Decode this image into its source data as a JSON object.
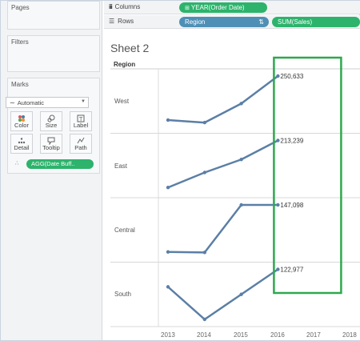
{
  "sidebar": {
    "pages_title": "Pages",
    "filters_title": "Filters",
    "marks_title": "Marks",
    "mark_type": "Automatic",
    "mark_buttons": [
      {
        "label": "Color",
        "icon": "color-dots-icon"
      },
      {
        "label": "Size",
        "icon": "size-icon"
      },
      {
        "label": "Label",
        "icon": "label-icon"
      },
      {
        "label": "Detail",
        "icon": "detail-icon"
      },
      {
        "label": "Tooltip",
        "icon": "tooltip-icon"
      },
      {
        "label": "Path",
        "icon": "path-icon"
      }
    ],
    "mark_field": "AGG(Date Buff.."
  },
  "shelves": {
    "columns_label": "Columns",
    "columns_pill": "YEAR(Order Date)",
    "rows_label": "Rows",
    "rows_pills": [
      "Region",
      "SUM(Sales)"
    ]
  },
  "sheet": {
    "title": "Sheet 2",
    "row_header": "Region"
  },
  "colors": {
    "line": "#5b7fa6",
    "highlight_box": "#2ea84f",
    "green_pill": "#2db36c",
    "blue_pill": "#4e8fb5"
  },
  "chart_data": {
    "type": "line",
    "x": [
      "2013",
      "2014",
      "2015",
      "2016",
      "2017",
      "2018"
    ],
    "panels": [
      {
        "region": "West",
        "values": [
          0.12,
          0.07,
          0.45,
          1.0
        ],
        "end_label": "250,633"
      },
      {
        "region": "East",
        "values": [
          0.06,
          0.36,
          0.62,
          1.0
        ],
        "end_label": "213,239"
      },
      {
        "region": "Central",
        "values": [
          0.06,
          0.05,
          1.0,
          1.0
        ],
        "end_label": "147,098"
      },
      {
        "region": "South",
        "values": [
          0.65,
          0.0,
          0.5,
          1.0
        ],
        "end_label": "122,977"
      }
    ],
    "highlight_year": "2016",
    "grid": true
  }
}
